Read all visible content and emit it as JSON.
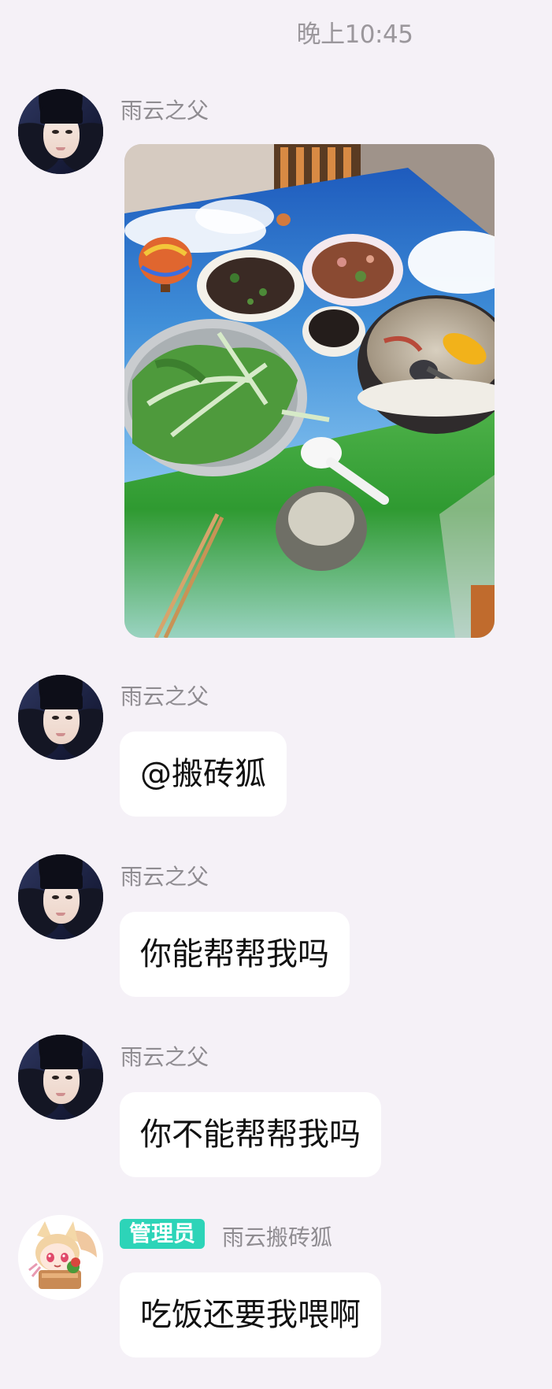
{
  "header": {
    "timestamp": "晚上10:45"
  },
  "messages": [
    {
      "sender": "雨云之父",
      "type": "image",
      "image_description": "photo"
    },
    {
      "sender": "雨云之父",
      "text": "@搬砖狐"
    },
    {
      "sender": "雨云之父",
      "text": "你能帮帮我吗"
    },
    {
      "sender": "雨云之父",
      "text": "你不能帮帮我吗"
    },
    {
      "sender": "雨云搬砖狐",
      "badge": "管理员",
      "text": "吃饭还要我喂啊"
    }
  ],
  "colors": {
    "background": "#f5f1f7",
    "bubble": "#ffffff",
    "sender_text": "#8f8c91",
    "timestamp_text": "#9b979c",
    "admin_badge": "#2dd4b8"
  }
}
